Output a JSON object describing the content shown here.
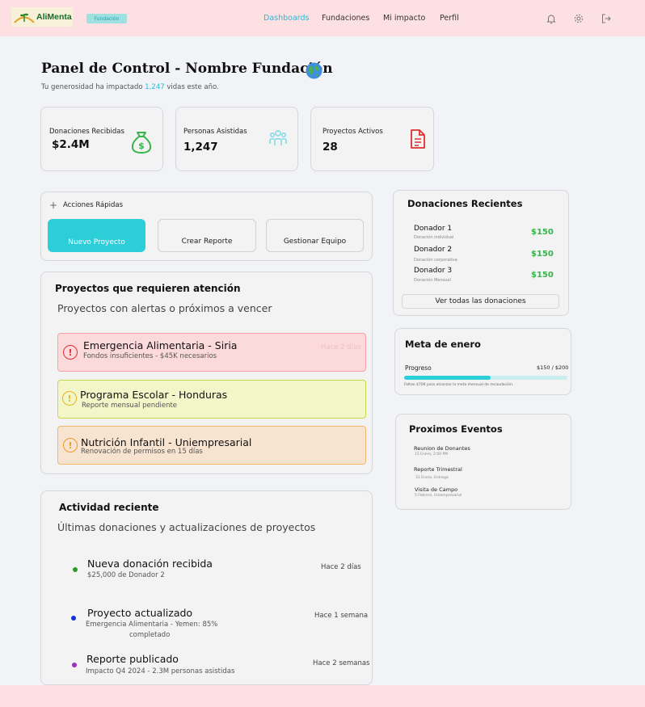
{
  "header": {
    "brand": "AliMenta",
    "role": "Fundación",
    "nav": [
      {
        "label": "Dashboards",
        "active": true
      },
      {
        "label": "Fundaciones",
        "active": false
      },
      {
        "label": "Mi impacto",
        "active": false
      },
      {
        "label": "Perfil",
        "active": false
      }
    ],
    "icons": [
      "bell-icon",
      "gear-icon",
      "logout-icon"
    ]
  },
  "page": {
    "title": "Panel de Control - Nombre Fundación",
    "subtitle_pre": "Tu generosidad ha impactado ",
    "subtitle_num": "1,247",
    "subtitle_post": " vidas este año."
  },
  "stats": [
    {
      "label": "Donaciones Recibidas",
      "value": "$2.4M",
      "icon": "money-bag-icon",
      "color": "#36b54a"
    },
    {
      "label": "Personas Asistidas",
      "value": "1,247",
      "icon": "people-icon",
      "color": "#7fd8e6"
    },
    {
      "label": "Proyectos Activos",
      "value": "28",
      "icon": "document-icon",
      "color": "#e0302f"
    }
  ],
  "quick_actions": {
    "title": "Acciones Rápidas",
    "buttons": [
      "Nuevo Proyecto",
      "Crear Reporte",
      "Gestionar Equipo"
    ]
  },
  "attention": {
    "title": "Proyectos que requieren atención",
    "subtitle": "Proyectos con alertas o próximos a vencer",
    "items": [
      {
        "title": "Emergencia Alimentaria - Siria",
        "sub": "Fondos insuficientes - $45K necesarios",
        "time": "Hace 2 días",
        "bg": "#fcd9db",
        "border": "#f3a3a9",
        "icon_color": "#e0302f"
      },
      {
        "title": "Programa Escolar - Honduras",
        "sub": "Reporte mensual pendiente",
        "bg": "#f2f6c8",
        "border": "#c7d84a",
        "icon_color": "#e8b820"
      },
      {
        "title": "Nutrición Infantil - Uniempresarial",
        "sub": "Renovación de permisos en 15 días",
        "bg": "#f8e2d0",
        "border": "#f4b66a",
        "icon_color": "#f09a2a"
      }
    ]
  },
  "activity": {
    "title": "Actividad reciente",
    "subtitle": "Últimas donaciones y actualizaciones de proyectos",
    "items": [
      {
        "title": "Nueva donación recibida",
        "sub": "$25,000 de Donador 2",
        "sub2": "",
        "time": "Hace 2 días",
        "color": "#2a9a2a"
      },
      {
        "title": "Proyecto actualizado",
        "sub": "Emergencia Alimentaria - Yemen: 85%",
        "sub2": "completado",
        "time": "Hace 1 semana",
        "color": "#1530d6"
      },
      {
        "title": "Reporte publicado",
        "sub": "Impacto Q4 2024 - 2.3M personas asistidas",
        "sub2": "",
        "time": "Hace 2 semanas",
        "color": "#9b2fc4"
      }
    ]
  },
  "recent_donations": {
    "title": "Donaciones Recientes",
    "items": [
      {
        "name": "Donador 1",
        "type": "Donación individual",
        "amount": "$150"
      },
      {
        "name": "Donador 2",
        "type": "Donación corporativa",
        "amount": "$150"
      },
      {
        "name": "Donador 3",
        "type": "Donación Mensual",
        "amount": "$150"
      }
    ],
    "see_all": "Ver todas las donaciones"
  },
  "goal": {
    "title": "Meta de enero",
    "progress_label": "Progreso",
    "progress_value": "$150 / $200",
    "progress_fraction": 0.53,
    "note": "Faltan $70K para alcanzar la meta mensual de recaudación."
  },
  "events": {
    "title": "Proximos Eventos",
    "items": [
      {
        "title": "Reunion de Donantes",
        "sub": "15 Enero, 2:00 PM"
      },
      {
        "title": "Reporte Trimestral",
        "sub": "31 Enero, Entrega"
      },
      {
        "title": "Visita de Campo",
        "sub": "5 Febrero, Uniempresarial"
      }
    ]
  }
}
